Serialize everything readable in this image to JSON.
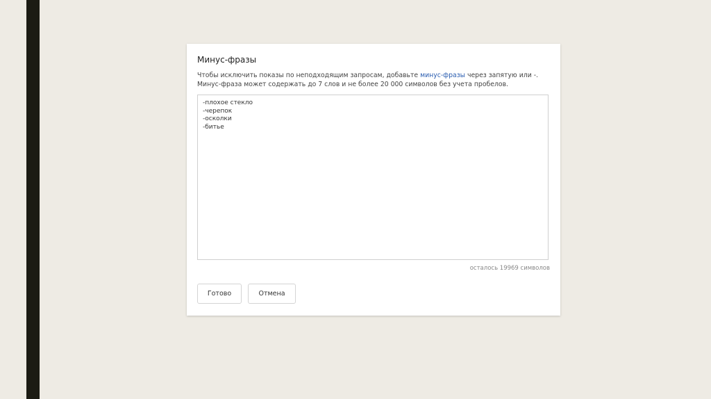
{
  "dialog": {
    "title": "Минус-фразы",
    "description_before": "Чтобы исключить показы по неподходящим запросам, добавьте ",
    "description_link": "минус-фразы",
    "description_after": " через запятую или -.",
    "description_line2": "Минус-фраза может содержать до 7 слов и не более 20 000 символов без учета пробелов.",
    "textarea_value": "-плохое стекло\n-черепок\n-осколки\n-битье",
    "counter": "осталось 19969 символов",
    "done_label": "Готово",
    "cancel_label": "Отмена"
  }
}
